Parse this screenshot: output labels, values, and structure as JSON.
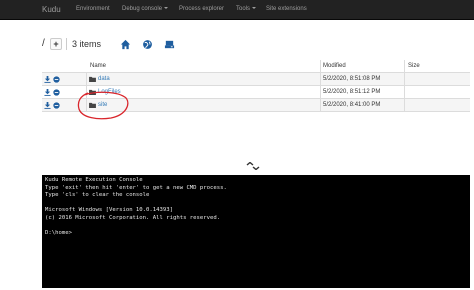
{
  "navbar": {
    "brand": "Kudu",
    "items": [
      {
        "label": "Environment",
        "dropdown": false
      },
      {
        "label": "Debug console",
        "dropdown": true
      },
      {
        "label": "Process explorer",
        "dropdown": false
      },
      {
        "label": "Tools",
        "dropdown": true
      },
      {
        "label": "Site extensions",
        "dropdown": false
      }
    ]
  },
  "toolbar": {
    "path": "/",
    "add_label": "+",
    "item_count": "3 items",
    "icons": [
      "home-icon",
      "globe-icon",
      "drive-icon"
    ]
  },
  "table": {
    "headers": {
      "name": "Name",
      "modified": "Modified",
      "size": "Size"
    },
    "rows": [
      {
        "name": "data",
        "modified": "5/2/2020, 8:51:08 PM",
        "size": ""
      },
      {
        "name": "LogFiles",
        "modified": "5/2/2020, 8:51:12 PM",
        "size": ""
      },
      {
        "name": "site",
        "modified": "5/2/2020, 8:41:00 PM",
        "size": ""
      }
    ]
  },
  "console": {
    "lines": [
      "Kudu Remote Execution Console",
      "Type 'exit' then hit 'enter' to get a new CMD process.",
      "Type 'cls' to clear the console",
      "",
      "Microsoft Windows [Version 10.0.14393]",
      "(c) 2016 Microsoft Corporation. All rights reserved.",
      "",
      "D:\\home>"
    ]
  },
  "colors": {
    "navbar_bg": "#222222",
    "nav_text": "#9d9d9d",
    "link": "#337ab7",
    "annotation": "#d9262c",
    "console_bg": "#000000"
  }
}
